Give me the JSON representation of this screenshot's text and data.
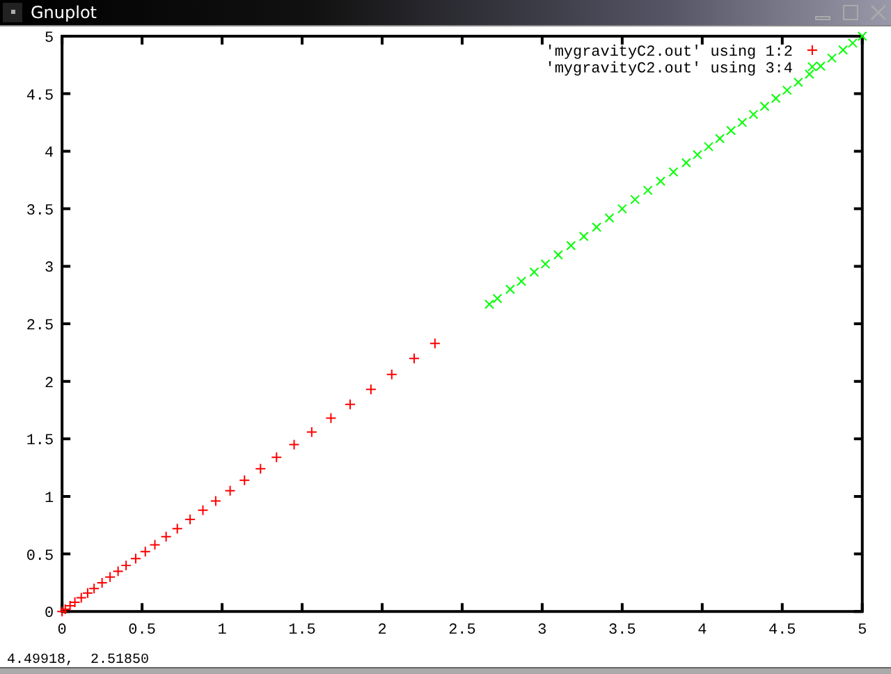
{
  "window": {
    "title": "Gnuplot"
  },
  "plot": {
    "chart_data": {
      "type": "scatter",
      "xlim": [
        0,
        5
      ],
      "ylim": [
        0,
        5
      ],
      "xticks": [
        0,
        0.5,
        1,
        1.5,
        2,
        2.5,
        3,
        3.5,
        4,
        4.5,
        5
      ],
      "yticks": [
        0,
        0.5,
        1,
        1.5,
        2,
        2.5,
        3,
        3.5,
        4,
        4.5,
        5
      ],
      "series": [
        {
          "name": "'mygravityC2.out' using 1:2",
          "color": "#ff0000",
          "x": [
            0,
            0.02,
            0.05,
            0.08,
            0.12,
            0.16,
            0.2,
            0.25,
            0.3,
            0.35,
            0.4,
            0.46,
            0.52,
            0.58,
            0.65,
            0.72,
            0.8,
            0.88,
            0.96,
            1.05,
            1.14,
            1.24,
            1.34,
            1.45,
            1.56,
            1.68,
            1.8,
            1.93,
            2.06,
            2.2,
            2.33
          ],
          "values": [
            0,
            0.02,
            0.05,
            0.08,
            0.12,
            0.16,
            0.2,
            0.25,
            0.3,
            0.35,
            0.4,
            0.46,
            0.52,
            0.58,
            0.65,
            0.72,
            0.8,
            0.88,
            0.96,
            1.05,
            1.14,
            1.24,
            1.34,
            1.45,
            1.56,
            1.68,
            1.8,
            1.93,
            2.06,
            2.2,
            2.33
          ]
        },
        {
          "name": "'mygravityC2.out' using 3:4",
          "color": "#00ff00",
          "x": [
            2.67,
            2.72,
            2.8,
            2.87,
            2.95,
            3.02,
            3.1,
            3.18,
            3.26,
            3.34,
            3.42,
            3.5,
            3.58,
            3.66,
            3.74,
            3.82,
            3.9,
            3.97,
            4.04,
            4.11,
            4.18,
            4.25,
            4.32,
            4.39,
            4.46,
            4.53,
            4.6,
            4.67,
            4.74,
            4.81,
            4.88,
            4.94,
            5
          ],
          "values": [
            2.67,
            2.72,
            2.8,
            2.87,
            2.95,
            3.02,
            3.1,
            3.18,
            3.26,
            3.34,
            3.42,
            3.5,
            3.58,
            3.66,
            3.74,
            3.82,
            3.9,
            3.97,
            4.04,
            4.11,
            4.18,
            4.25,
            4.32,
            4.39,
            4.46,
            4.53,
            4.6,
            4.67,
            4.74,
            4.81,
            4.88,
            4.94,
            5
          ]
        }
      ],
      "legend": "top right"
    }
  },
  "status_bar": {
    "coordinates": "4.49918,  2.51850"
  }
}
